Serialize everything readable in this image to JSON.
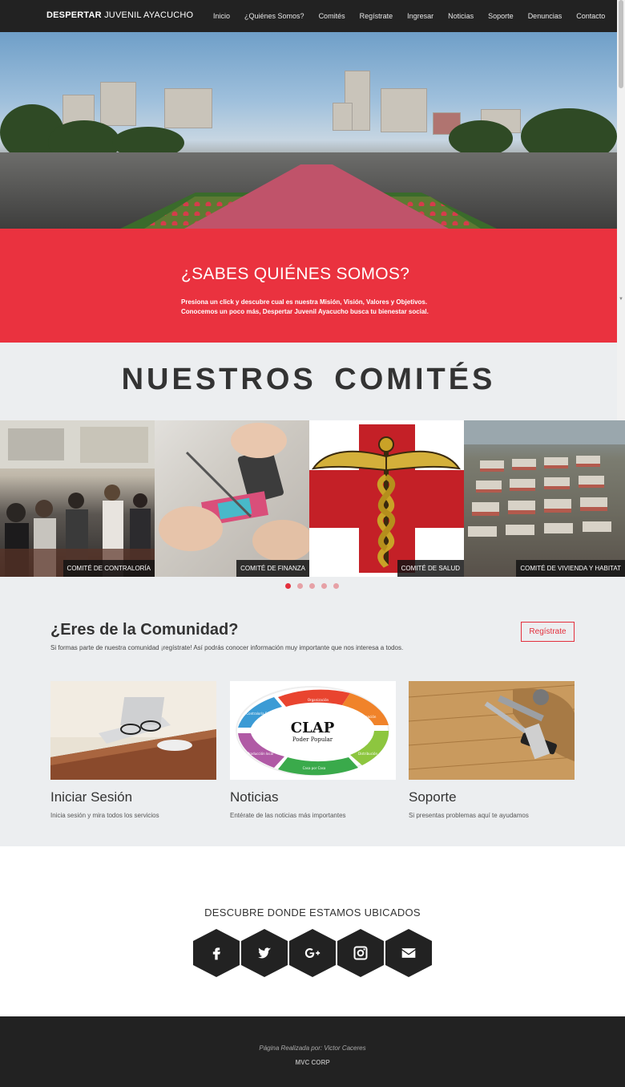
{
  "navbar": {
    "brand_bold": "DESPERTAR",
    "brand_rest": "JUVENIL AYACUCHO",
    "links": [
      "Inicio",
      "¿Quiénes Somos?",
      "Comités",
      "Regístrate",
      "Ingresar",
      "Noticias",
      "Soporte",
      "Denuncias",
      "Contacto"
    ]
  },
  "who": {
    "title": "¿SABES QUIÉNES SOMOS?",
    "line1": "Presiona un click y descubre cual es nuestra Misión, Visión, Valores y Objetivos.",
    "line2": "Conocemos un poco más, Despertar Juvenil Ayacucho busca tu bienestar social."
  },
  "comites": {
    "title": "NUESTROS COMITÉS",
    "tiles": [
      "COMITÉ DE CONTRALORÍA",
      "COMITÉ DE FINANZA",
      "COMITÉ DE SALUD",
      "COMITÉ DE VIVIENDA Y HABITAT"
    ],
    "carousel_dots": 5,
    "active_dot": 0
  },
  "comunidad": {
    "title": "¿Eres de la Comunidad?",
    "text": "Si formas parte de nuestra comunidad ¡regístrate! Así podrás conocer información muy importante que nos interesa a todos.",
    "button": "Regístrate",
    "cards": [
      {
        "title": "Iniciar Sesión",
        "text": "Inicia sesión y mira todos los servicios"
      },
      {
        "title": "Noticias",
        "text": "Entérate de las noticias más importantes"
      },
      {
        "title": "Soporte",
        "text": "Si presentas problemas aquí te ayudamos"
      }
    ],
    "clap": {
      "title": "CLAP",
      "subtitle": "Poder Popular",
      "segments": [
        "Organización",
        "Formación",
        "Distribución",
        "Casa por Casa",
        "Producción local",
        "Contraloría Social"
      ]
    }
  },
  "location": {
    "title": "DESCUBRE DONDE ESTAMOS UBICADOS",
    "social": [
      "facebook-icon",
      "twitter-icon",
      "google-plus-icon",
      "instagram-icon",
      "email-icon"
    ]
  },
  "footer": {
    "made_by": "Página Realizada por: Victor Caceres",
    "corp": "MVC CORP"
  },
  "colors": {
    "accent": "#ea323f",
    "dark": "#222222",
    "section_bg": "#eceef0"
  }
}
